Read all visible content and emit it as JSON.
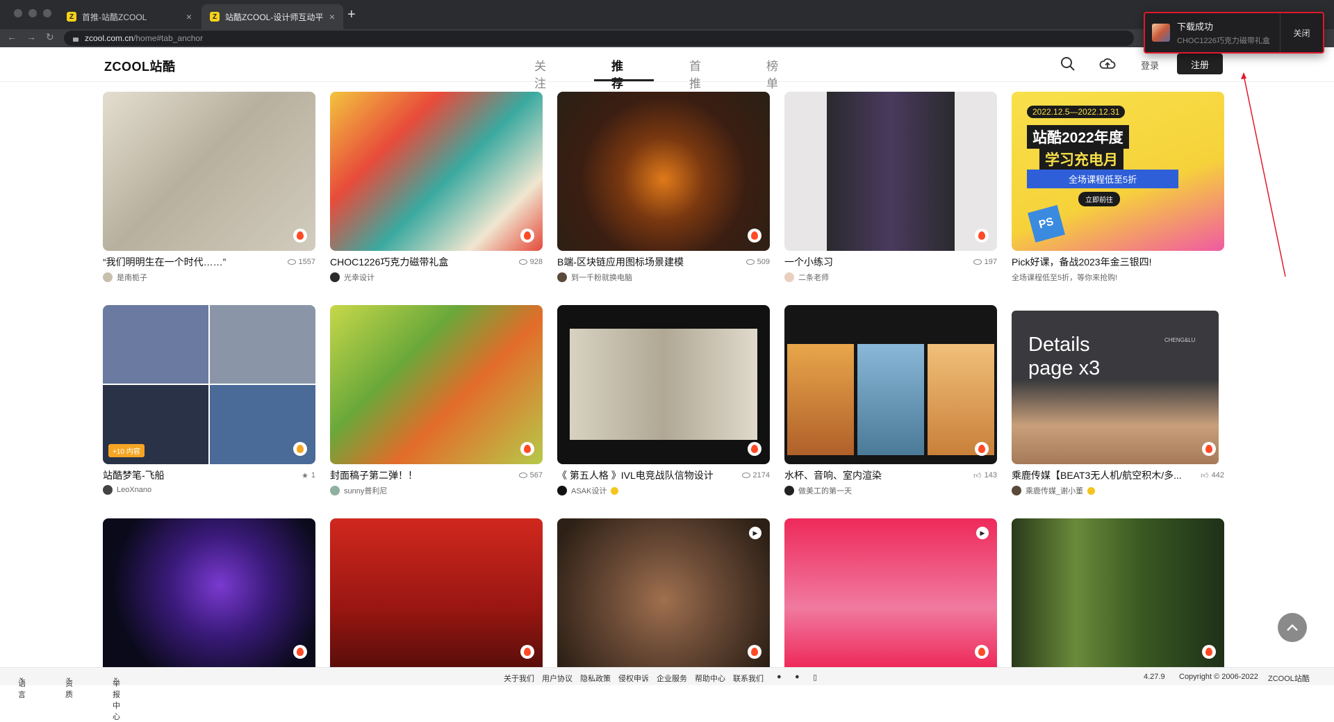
{
  "browser": {
    "tabs": [
      {
        "title": "首推-站酷ZCOOL",
        "favicon": "Z"
      },
      {
        "title": "站酷ZCOOL-设计师互动平台-打",
        "favicon": "Z"
      }
    ],
    "url_host": "zcool.com.cn",
    "url_path": "/home#tab_anchor"
  },
  "download_toast": {
    "title": "下载成功",
    "filename": "CHOC1226巧克力磁带礼盒",
    "close_label": "关闭"
  },
  "site": {
    "logo": "ZCOOL站酷",
    "nav": [
      {
        "label": "关注",
        "active": false
      },
      {
        "label": "推荐",
        "active": true
      },
      {
        "label": "首推",
        "active": false
      },
      {
        "label": "榜单",
        "active": false
      }
    ],
    "login": "登录",
    "register": "注册"
  },
  "cards": [
    {
      "title": "“我们明明生在一个时代……”",
      "stat": "1557",
      "stat_icon": "eye-icon",
      "author": "是南栀子",
      "colors": [
        "#c9c2b1",
        "#8f887a"
      ]
    },
    {
      "title": "CHOC1226巧克力磁带礼盒",
      "stat": "928",
      "stat_icon": "eye-icon",
      "author": "光幸设计",
      "colors": [
        "#f2c14b",
        "#e44a3a"
      ]
    },
    {
      "title": "B端-区块链应用图标场景建模",
      "stat": "509",
      "stat_icon": "eye-icon",
      "author": "到一千粉就换电脑",
      "colors": [
        "#3b2a1c",
        "#d9771b"
      ]
    },
    {
      "title": "一个小练习",
      "stat": "197",
      "stat_icon": "eye-icon",
      "author": "二条老师",
      "colors": [
        "#e9e4e1",
        "#5c4a6a"
      ]
    },
    {
      "title": "Pick好课，备战2023年金三银四!",
      "stat": "",
      "stat_icon": "",
      "author": "",
      "subtext": "全场课程低至5折，等你来抢购!",
      "colors": [
        "#f7d83f",
        "#f05aa2"
      ]
    },
    {
      "title": "站酷梦笔-飞船",
      "stat": "1",
      "stat_icon": "star-icon",
      "author": "LeoXnano",
      "plus": "+10 内容",
      "colors": [
        "#7a8aa8",
        "#2e3a52"
      ]
    },
    {
      "title": "封面稿子第二弹！！",
      "stat": "567",
      "stat_icon": "eye-icon",
      "author": "sunny普利尼",
      "colors": [
        "#b4c94a",
        "#e36c2a"
      ]
    },
    {
      "title": "《 第五人格 》IVL电竞战队信物设计",
      "stat": "2174",
      "stat_icon": "eye-icon",
      "author": "ASAK设计",
      "verified": true,
      "colors": [
        "#d6d0c2",
        "#1a1a1a"
      ]
    },
    {
      "title": "水杯、音响、室内渲染",
      "stat": "143",
      "stat_icon": "thumb-icon",
      "author": "做美工的第一天",
      "colors": [
        "#e89a3a",
        "#1c2430"
      ]
    },
    {
      "title": "乘鹿传媒【BEAT3无人机/航空积木/多...",
      "stat": "442",
      "stat_icon": "thumb-icon",
      "author": "乘鹿传媒_谢小董",
      "verified": true,
      "colors": [
        "#3b3b3f",
        "#c9a07a"
      ]
    },
    {
      "title": "",
      "stat": "",
      "author": "",
      "colors": [
        "#2a1d5a",
        "#c04a8a"
      ]
    },
    {
      "title": "",
      "stat": "",
      "author": "",
      "colors": [
        "#c8221c",
        "#5a0e0a"
      ]
    },
    {
      "title": "",
      "stat": "",
      "author": "",
      "colors": [
        "#6a4a36",
        "#2d2016"
      ]
    },
    {
      "title": "",
      "stat": "",
      "author": "",
      "colors": [
        "#ee2a5a",
        "#f6b0c6"
      ]
    },
    {
      "title": "",
      "stat": "",
      "author": "",
      "colors": [
        "#6a8a3a",
        "#1f3018"
      ]
    }
  ],
  "banner_text": {
    "date": "2022.12.5—2022.12.31",
    "headline1": "站酷2022年度",
    "headline2": "学习充电月",
    "sub": "全场课程低至5折",
    "cta": "立即前往"
  },
  "details_text": {
    "line1": "Details",
    "line2": "page x3",
    "brand": "CHENG&LU"
  },
  "footer": {
    "language": "语言",
    "resources": "资质",
    "report": "举报中心",
    "links": [
      "关于我们",
      "用户协议",
      "隐私政策",
      "侵权申诉",
      "企业服务",
      "帮助中心",
      "联系我们"
    ],
    "version": "4.27.9",
    "copyright": "Copyright © 2006-2022",
    "brand": "ZCOOL站酷"
  }
}
